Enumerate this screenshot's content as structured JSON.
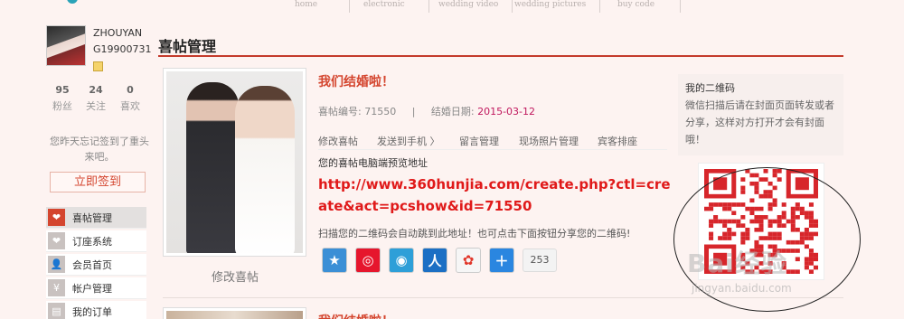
{
  "topnav": {
    "items": [
      "home",
      "electronic",
      "wedding video",
      "wedding pictures",
      "buy code"
    ]
  },
  "user": {
    "name_line1": "ZHOUYAN",
    "name_line2": "G19900731"
  },
  "stats": [
    {
      "num": "95",
      "label": "粉丝"
    },
    {
      "num": "24",
      "label": "关注"
    },
    {
      "num": "0",
      "label": "喜欢"
    }
  ],
  "checkin": {
    "note": "您昨天忘记签到了重头来吧。",
    "button": "立即签到"
  },
  "sidebar": {
    "items": [
      {
        "label": "喜帖管理",
        "icon": "heart-icon"
      },
      {
        "label": "订座系统",
        "icon": "heart-icon"
      },
      {
        "label": "会员首页",
        "icon": "user-icon"
      },
      {
        "label": "帐户管理",
        "icon": "yen-icon"
      },
      {
        "label": "我的订单",
        "icon": "document-icon"
      }
    ]
  },
  "page": {
    "title": "喜帖管理"
  },
  "post": {
    "title": "我们结婚啦！",
    "id_label": "喜帖编号: 71550",
    "divider": "|",
    "date_label": "结婚日期: ",
    "date": "2015-03-12",
    "actions": [
      "修改喜帖",
      "发送到手机 〉",
      "留言管理",
      "现场照片管理",
      "宾客排座"
    ],
    "preview_label": "您的喜帖电脑端预览地址",
    "preview_url": "http://www.360hunjia.com/create.php?ctl=create&act=pcshow&id=71550",
    "qr_hint": "扫描您的二维码会自动跳到此地址！也可点击下面按钮分享您的二维码!",
    "edit_link": "修改喜帖",
    "share_count": "253",
    "next_title": "我们结婚啦！"
  },
  "qr": {
    "title": "我的二维码",
    "desc": "微信扫描后请在封面页面转发或者分享，这样对方打开才会有封面哦！"
  },
  "watermark": {
    "main": "Bai经验",
    "sub": "jingyan.baidu.com"
  },
  "colors": {
    "accent": "#d4452e",
    "date": "#c0175d",
    "url": "#e01a1a",
    "qr": "#d7262b"
  }
}
